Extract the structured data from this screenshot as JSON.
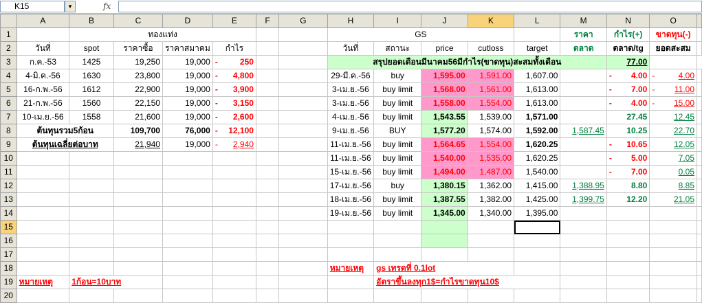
{
  "namebox": "K15",
  "fx_label": "fx",
  "columns": [
    "A",
    "B",
    "C",
    "D",
    "E",
    "F",
    "G",
    "H",
    "I",
    "J",
    "K",
    "L",
    "M",
    "N",
    "O"
  ],
  "rows": [
    "1",
    "2",
    "3",
    "4",
    "5",
    "6",
    "7",
    "8",
    "9",
    "10",
    "11",
    "12",
    "13",
    "14",
    "15",
    "16",
    "17",
    "18",
    "19",
    "20"
  ],
  "left": {
    "title": "ทองแท่ง",
    "headers": [
      "วันที่",
      "spot",
      "ราคาซื้อ",
      "ราคาสมาคม",
      "กำไร"
    ],
    "data": [
      [
        "ก.ค.-53",
        "1425",
        "19,250",
        "19,000",
        "250"
      ],
      [
        "4-มิ.ค.-56",
        "1630",
        "23,800",
        "19,000",
        "4,800"
      ],
      [
        "16-ก.พ.-56",
        "1612",
        "22,900",
        "19,000",
        "3,900"
      ],
      [
        "21-ก.พ.-56",
        "1560",
        "22,150",
        "19,000",
        "3,150"
      ],
      [
        "10-เม.ย.-56",
        "1558",
        "21,600",
        "19,000",
        "2,600"
      ]
    ],
    "total_label": "ต้นทุนรวม5ก้อน",
    "total_buy": "109,700",
    "total_assoc": "76,000",
    "total_profit": "12,100",
    "avg_label": "ต้นทุนเฉลี่ยต่อบาท",
    "avg_buy": "21,940",
    "avg_assoc": "19,000",
    "avg_profit": "2,940",
    "note_label": "หมายเหตุ",
    "note_text": "1ก้อน=10บาท",
    "dash": "-"
  },
  "right": {
    "title": "GS",
    "col_L_top": "ราคา",
    "col_L_sub": "ตลาด",
    "col_M_top": "กำไร(+)",
    "col_M_sub": "ตลาด/tg",
    "col_N_top": "ขาดทุน(-)",
    "col_N_sub": "ยอดสะสม",
    "headers": [
      "วันที่",
      "สถานะ",
      "price",
      "cutloss",
      "target"
    ],
    "summary_label": "สรุปยอดเดือนมีนาคม56มีกำไร(ขาดทุน)สะสมทั้งเดือน",
    "summary_value": "77.00",
    "trades": [
      {
        "date": "29-มี.ค.-56",
        "status": "buy",
        "price": "1,595.00",
        "cutloss": "1,591.00",
        "target": "1,607.00",
        "market": "",
        "pl": "4.00",
        "cum": "4.00"
      },
      {
        "date": "3-เม.ย.-56",
        "status": "buy limit",
        "price": "1,568.00",
        "cutloss": "1,561.00",
        "target": "1,613.00",
        "market": "",
        "pl": "7.00",
        "cum": "11.00"
      },
      {
        "date": "3-เม.ย.-56",
        "status": "buy limit",
        "price": "1,558.00",
        "cutloss": "1,554.00",
        "target": "1,613.00",
        "market": "",
        "pl": "4.00",
        "cum": "15.00"
      },
      {
        "date": "4-เม.ย.-56",
        "status": "buy limit",
        "price": "1,543.55",
        "cutloss": "1,539.00",
        "target": "1,571.00",
        "market": "",
        "pl": "27.45",
        "cum": "12.45"
      },
      {
        "date": "9-เม.ย.-56",
        "status": "BUY",
        "price": "1,577.20",
        "cutloss": "1,574.00",
        "target": "1,592.00",
        "market": "1,587.45",
        "pl": "10.25",
        "cum": "22.70"
      },
      {
        "date": "11-เม.ย.-56",
        "status": "buy limit",
        "price": "1,564.65",
        "cutloss": "1,554.00",
        "target": "1,620.25",
        "market": "",
        "pl": "10.65",
        "cum": "12.05"
      },
      {
        "date": "11-เม.ย.-56",
        "status": "buy limit",
        "price": "1,540.00",
        "cutloss": "1,535.00",
        "target": "1,620.25",
        "market": "",
        "pl": "5.00",
        "cum": "7.05"
      },
      {
        "date": "15-เม.ย.-56",
        "status": "buy limit",
        "price": "1,494.00",
        "cutloss": "1,487.00",
        "target": "1,540.00",
        "market": "",
        "pl": "7.00",
        "cum": "0.05"
      },
      {
        "date": "17-เม.ย.-56",
        "status": "buy",
        "price": "1,380.15",
        "cutloss": "1,362.00",
        "target": "1,415.00",
        "market": "1,388.95",
        "pl": "8.80",
        "cum": "8.85"
      },
      {
        "date": "18-เม.ย.-56",
        "status": "buy limit",
        "price": "1,387.55",
        "cutloss": "1,382.00",
        "target": "1,425.00",
        "market": "1,399.75",
        "pl": "12.20",
        "cum": "21.05"
      },
      {
        "date": "19-เม.ย.-56",
        "status": "buy limit",
        "price": "1,345.00",
        "cutloss": "1,340.00",
        "target": "1,395.00",
        "market": "",
        "pl": "",
        "cum": ""
      }
    ],
    "note_label": "หมายเหตุ",
    "note_line1": "gs เทรดที่ 0.1lot",
    "note_line2": "อัตราขึ้นลงทุก1$=กำไรขาดทุน10$"
  },
  "colors": {
    "header_bg": "#e6e4d8",
    "selected_header": "#f8d37a",
    "pink": "#ff99cc",
    "light_green": "#ccffcc",
    "red": "#ff0000",
    "green": "#008040"
  }
}
